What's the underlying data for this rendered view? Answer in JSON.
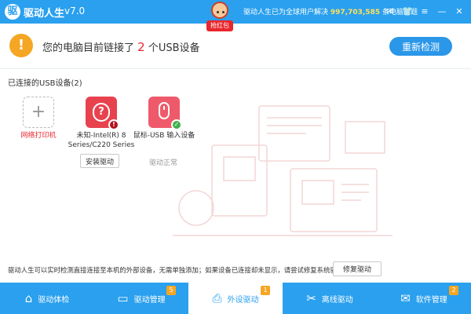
{
  "titlebar": {
    "logo_glyph": "驱",
    "app_name": "驱动人生",
    "version": "v7.0",
    "mascot_badge": "抢红包",
    "stats_prefix": "驱动人生已为全球用户解决",
    "stats_number": "997,703,585",
    "stats_suffix": "条电脑问题",
    "icons": [
      "mail-icon",
      "shirt-icon",
      "menu-icon",
      "minimize-icon",
      "close-icon"
    ]
  },
  "banner": {
    "msg_prefix": "您的电脑目前链接了",
    "count": "2",
    "msg_suffix": "个USB设备",
    "rescan_label": "重新检测"
  },
  "section": {
    "title": "已连接的USB设备(2)"
  },
  "devices": {
    "printer": {
      "label": "网络打印机",
      "tile": "+"
    },
    "unknown": {
      "label_line1": "未知-Intel(R) 8",
      "label_line2": "Series/C220 Series",
      "glyph": "?",
      "badge": "!"
    },
    "mouse": {
      "label": "鼠标-USB 输入设备",
      "badge": "✓"
    }
  },
  "actions": {
    "install_label": "安装驱动",
    "status_normal": "驱动正常"
  },
  "footer": {
    "hint": "驱动人生可以实时检测直接连接至本机的外部设备，无需单独添加；如果设备已连接却未显示，请尝试修复系统驱动:",
    "repair_label": "修复驱动"
  },
  "nav": {
    "items": [
      {
        "label": "驱动体检",
        "icon": "home-icon",
        "glyph": "⌂",
        "badge": ""
      },
      {
        "label": "驱动管理",
        "icon": "monitor-icon",
        "glyph": "▭",
        "badge": "5"
      },
      {
        "label": "外设驱动",
        "icon": "printer-icon",
        "glyph": "⎙",
        "badge": "1"
      },
      {
        "label": "离线驱动",
        "icon": "tools-icon",
        "glyph": "✂",
        "badge": ""
      },
      {
        "label": "软件管理",
        "icon": "box-icon",
        "glyph": "✉",
        "badge": "2"
      }
    ]
  },
  "colors": {
    "primary": "#2aa0ee",
    "warning": "#f5a623",
    "danger": "#e8262c",
    "success": "#3fb24a"
  }
}
